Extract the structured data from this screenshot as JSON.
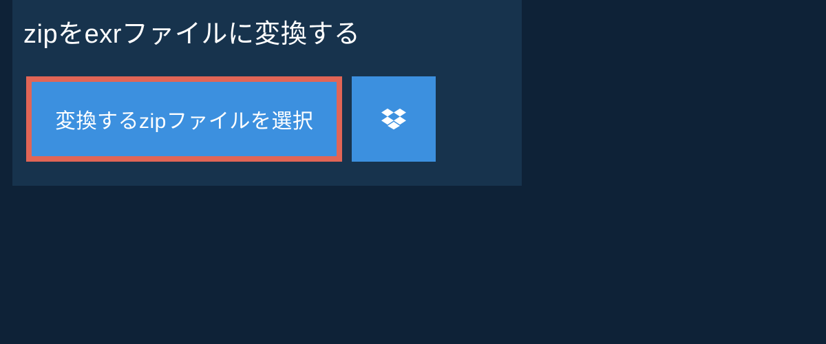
{
  "heading": "zipをexrファイルに変換する",
  "buttons": {
    "select_file": "変換するzipファイルを選択"
  }
}
